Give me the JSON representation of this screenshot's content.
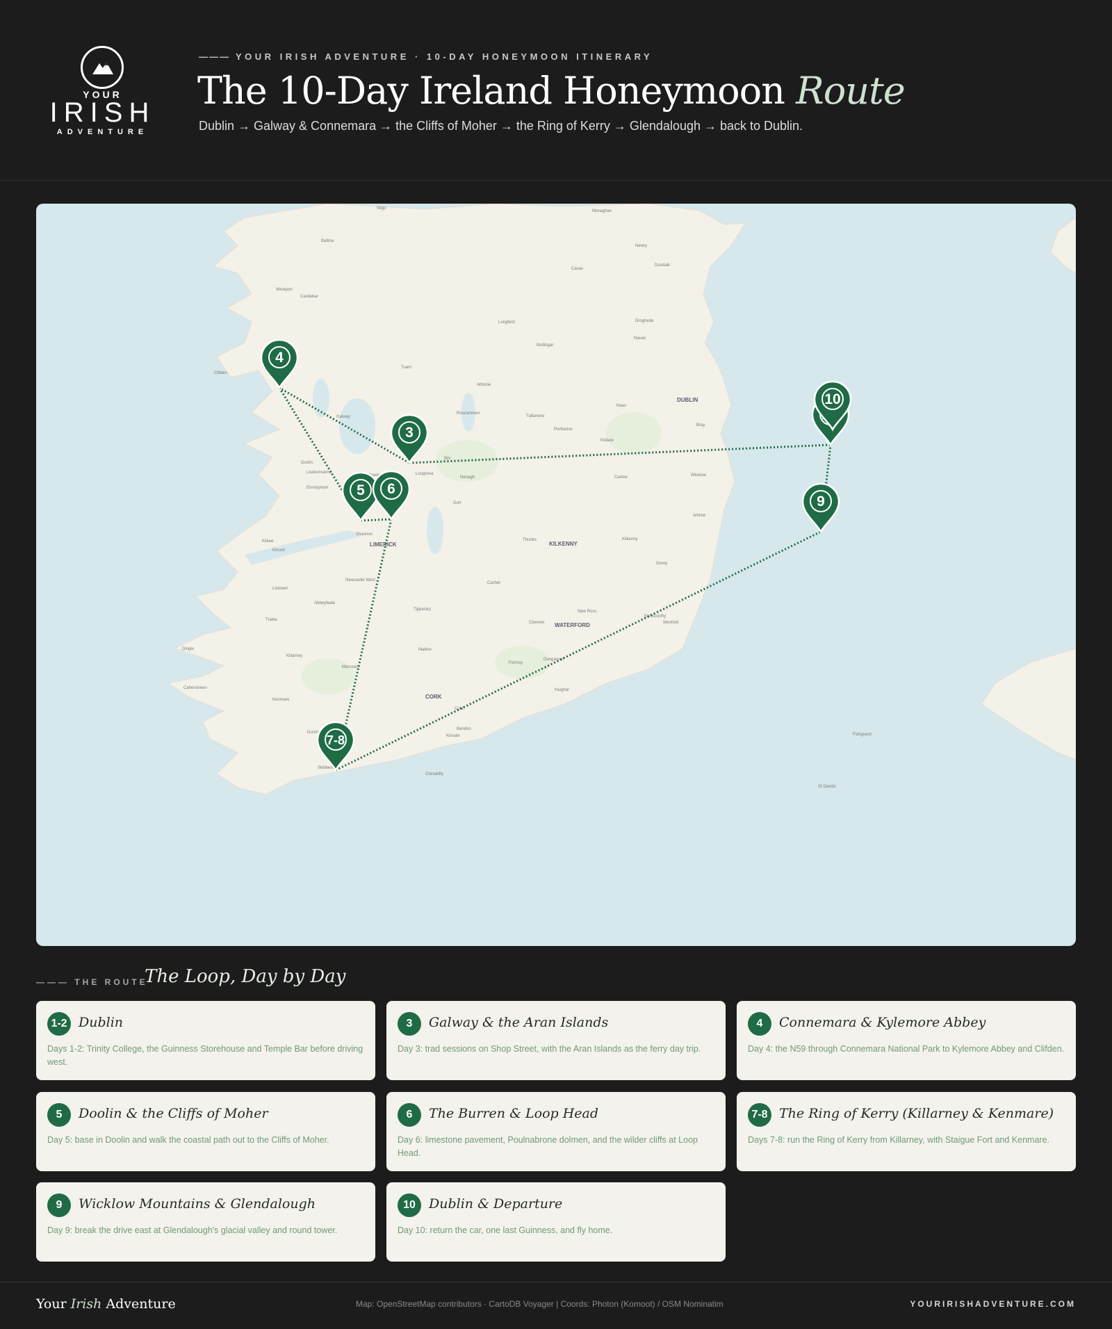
{
  "header": {
    "eyebrow": "YOUR IRISH ADVENTURE · 10-DAY HONEYMOON ITINERARY",
    "title_main": "The 10-Day Ireland Honeymoon ",
    "title_accent": "Route",
    "subtitle": "Dublin → Galway & Connemara → the Cliffs of Moher → the Ring of Kerry → Glendalough → back to Dublin."
  },
  "logo": {
    "top": "YOUR",
    "middle": "IRISH",
    "bottom": "ADVENTURE"
  },
  "map": {
    "place_labels": [
      "Sligo",
      "Ballina",
      "Westport",
      "Castlebar",
      "Clifden",
      "Tuam",
      "Galway",
      "Athlone",
      "Mullingar",
      "Navan",
      "Drogheda",
      "Dundalk",
      "Newry",
      "Longford",
      "Roscommon",
      "Tullamore",
      "Portlaoise",
      "Kildare",
      "Naas",
      "DUBLIN",
      "Bray",
      "Wicklow",
      "Arklow",
      "Carlow",
      "KILKENNY",
      "Thurles",
      "Nenagh",
      "Ennis",
      "Shannon",
      "LIMERICK",
      "Kilrush",
      "Kilkee",
      "Listowel",
      "Tralee",
      "Killarney",
      "Kenmare",
      "Dingle",
      "Cahersiveen",
      "Mallow",
      "CORK",
      "Cobh",
      "Kinsale",
      "Bandon",
      "Clonakilty",
      "Skibbereen",
      "Bantry",
      "Fermoy",
      "Youghal",
      "Dungarvan",
      "Clonmel",
      "Cashel",
      "Tipperary",
      "WATERFORD",
      "Wexford",
      "Enniscorthy",
      "Gorey",
      "New Ross",
      "Fishguard",
      "St Davids",
      "Cavan",
      "Monaghan",
      "Birr",
      "Ballinasloe",
      "Loughrea",
      "Gort",
      "Doolin",
      "Lisdoonvarna",
      "Ennistymon",
      "Kilkenny",
      "Abbeyfeale",
      "Newcastle West",
      "Macroom",
      "Dunmanway"
    ],
    "stops": [
      {
        "label": "4"
      },
      {
        "label": "3"
      },
      {
        "label": "5"
      },
      {
        "label": "6"
      },
      {
        "label": "7-8"
      },
      {
        "label": "9"
      },
      {
        "label": "1-2"
      },
      {
        "label": "10"
      }
    ],
    "route_color": "#1f6b45",
    "pin_color": "#1f6b45",
    "land_color": "#f4f1e9",
    "water_color": "#d6e8ec"
  },
  "route": {
    "eyebrow": "THE ROUTE",
    "title": "The Loop, Day by Day",
    "cards": [
      {
        "badge": "1-2",
        "title": "Dublin",
        "desc": "Days 1-2: Trinity College, the Guinness Storehouse and Temple Bar before driving west."
      },
      {
        "badge": "3",
        "title": "Galway & the Aran Islands",
        "desc": "Day 3: trad sessions on Shop Street, with the Aran Islands as the ferry day trip."
      },
      {
        "badge": "4",
        "title": "Connemara & Kylemore Abbey",
        "desc": "Day 4: the N59 through Connemara National Park to Kylemore Abbey and Clifden."
      },
      {
        "badge": "5",
        "title": "Doolin & the Cliffs of Moher",
        "desc": "Day 5: base in Doolin and walk the coastal path out to the Cliffs of Moher."
      },
      {
        "badge": "6",
        "title": "The Burren & Loop Head",
        "desc": "Day 6: limestone pavement, Poulnabrone dolmen, and the wilder cliffs at Loop Head."
      },
      {
        "badge": "7-8",
        "title": "The Ring of Kerry (Killarney & Kenmare)",
        "desc": "Days 7-8: run the Ring of Kerry from Killarney, with Staigue Fort and Kenmare."
      },
      {
        "badge": "9",
        "title": "Wicklow Mountains & Glendalough",
        "desc": "Day 9: break the drive east at Glendalough's glacial valley and round tower."
      },
      {
        "badge": "10",
        "title": "Dublin & Departure",
        "desc": "Day 10: return the car, one last Guinness, and fly home."
      }
    ]
  },
  "footer": {
    "brand_a": "Your ",
    "brand_b": "Irish",
    "brand_c": " Adventure",
    "credit": "Map: OpenStreetMap contributors · CartoDB Voyager | Coords: Photon (Komoot) / OSM Nominatim",
    "url": "YOURIRISHADVENTURE.COM"
  }
}
